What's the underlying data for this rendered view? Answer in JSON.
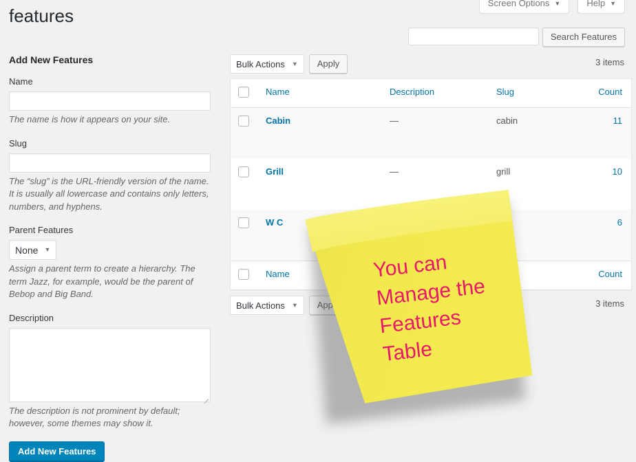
{
  "page": {
    "title": "features"
  },
  "top_tabs": [
    {
      "label": "Screen Options",
      "icon": "chevron-down-icon"
    },
    {
      "label": "Help",
      "icon": "chevron-down-icon"
    }
  ],
  "search": {
    "value": "",
    "placeholder": "",
    "button_label": "Search Features"
  },
  "form": {
    "heading": "Add New Features",
    "name_label": "Name",
    "name_value": "",
    "name_help": "The name is how it appears on your site.",
    "slug_label": "Slug",
    "slug_value": "",
    "slug_help": "The “slug” is the URL-friendly version of the name. It is usually all lowercase and contains only letters, numbers, and hyphens.",
    "parent_label": "Parent Features",
    "parent_value": "None",
    "parent_help": "Assign a parent term to create a hierarchy. The term Jazz, for example, would be the parent of Bebop and Big Band.",
    "description_label": "Description",
    "description_value": "",
    "description_help": "The description is not prominent by default; however, some themes may show it.",
    "submit_label": "Add New Features"
  },
  "tablenav_top": {
    "bulk_label": "Bulk Actions",
    "apply_label": "Apply",
    "items_count": "3 items"
  },
  "tablenav_bottom": {
    "bulk_label": "Bulk Actions",
    "apply_label": "Apply",
    "items_count": "3 items"
  },
  "table": {
    "columns": [
      "Name",
      "Description",
      "Slug",
      "Count"
    ],
    "rows": [
      {
        "name": "Cabin",
        "description": "—",
        "slug": "cabin",
        "count": "11"
      },
      {
        "name": "Grill",
        "description": "—",
        "slug": "grill",
        "count": "10"
      },
      {
        "name": "W C",
        "description": "—",
        "slug": "",
        "count": "6"
      }
    ]
  },
  "sticky_note": {
    "lines": [
      "You can",
      "Manage the",
      "Features",
      "Table"
    ],
    "paper_color": "#f0e84c",
    "paper_top_color": "#f6f070",
    "text_color": "#e8176b"
  }
}
